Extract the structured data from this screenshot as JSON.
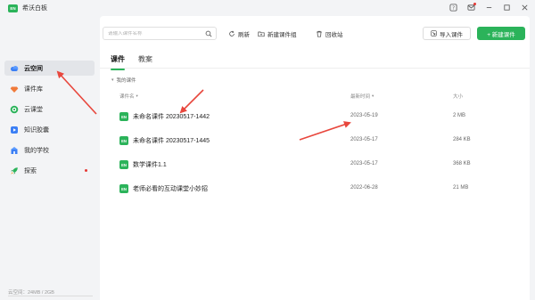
{
  "app": {
    "logo_text": "EN",
    "title": "希沃白板"
  },
  "window_controls": [
    {
      "name": "help-icon"
    },
    {
      "name": "mail-icon"
    },
    {
      "name": "minimize-icon"
    },
    {
      "name": "maximize-icon"
    },
    {
      "name": "close-icon"
    }
  ],
  "sidebar": {
    "items": [
      {
        "label": "云空间",
        "icon": "cloud-icon",
        "active": true,
        "color": "#3b7ff5"
      },
      {
        "label": "课件库",
        "icon": "diamond-icon",
        "active": false,
        "color": "#f07a3a"
      },
      {
        "label": "云课堂",
        "icon": "play-circle-icon",
        "active": false,
        "color": "#2bb35a"
      },
      {
        "label": "知识胶囊",
        "icon": "capsule-icon",
        "active": false,
        "color": "#3b7ff5"
      },
      {
        "label": "我的学校",
        "icon": "school-icon",
        "active": false,
        "color": "#3b7ff5"
      },
      {
        "label": "探索",
        "icon": "rocket-icon",
        "active": false,
        "color": "#2bb35a",
        "dot": true
      }
    ],
    "storage": "云空间：24MB / 2GB"
  },
  "toolbar": {
    "search_placeholder": "请输入课件名称",
    "refresh_label": "刷新",
    "new_group_label": "新建课件组",
    "recycle_label": "回收站",
    "import_label": "导入课件",
    "new_label": "+ 新建课件"
  },
  "tabs": [
    {
      "label": "课件",
      "active": true
    },
    {
      "label": "教案",
      "active": false
    }
  ],
  "breadcrumb": "我的课件",
  "columns": {
    "name": "课件名",
    "updated": "最新时间",
    "size": "大小"
  },
  "files": [
    {
      "icon_text": "EN",
      "name": "未命名课件 20230517-1442",
      "updated": "2023-05-19",
      "size": "2 MB"
    },
    {
      "icon_text": "EN",
      "name": "未命名课件 20230517-1445",
      "updated": "2023-05-17",
      "size": "284 KB"
    },
    {
      "icon_text": "EN",
      "name": "数学课件1.1",
      "updated": "2023-05-17",
      "size": "368 KB"
    },
    {
      "icon_text": "EN",
      "name": "老师必看的互动课堂小妙招",
      "updated": "2022-06-28",
      "size": "21 MB"
    }
  ],
  "colors": {
    "accent": "#2bb35a",
    "annotation_arrow": "#e8473d"
  }
}
